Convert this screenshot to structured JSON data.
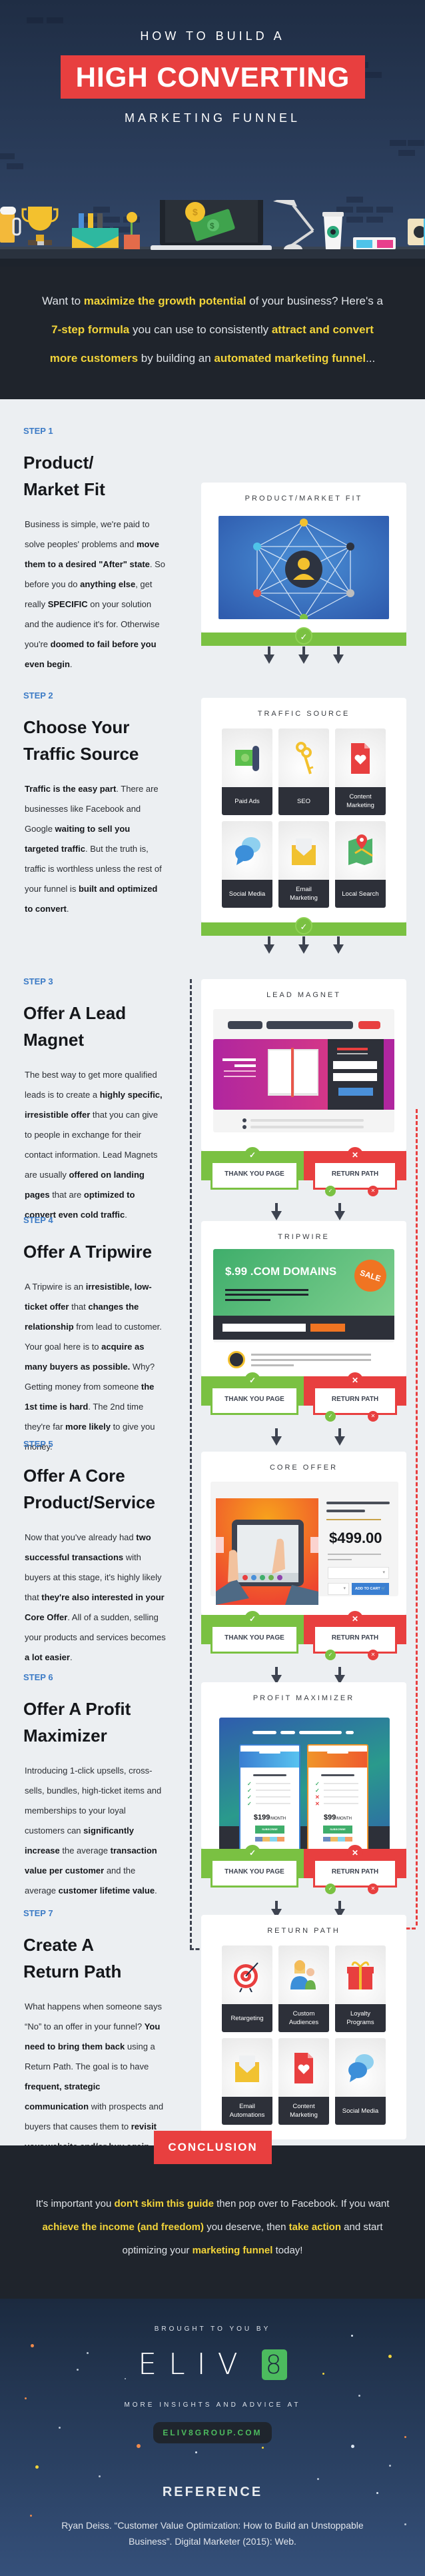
{
  "hero": {
    "pre_title": "HOW TO BUILD A",
    "badge": "HIGH CONVERTING",
    "post_title": "MARKETING FUNNEL"
  },
  "intro": {
    "parts": [
      {
        "t": "Want to ",
        "hl": false
      },
      {
        "t": "maximize the growth potential",
        "hl": true
      },
      {
        "t": " of your business? Here's a ",
        "hl": false
      },
      {
        "t": "7-step formula",
        "hl": true
      },
      {
        "t": " you can use to consistently ",
        "hl": false
      },
      {
        "t": "attract and convert more customers",
        "hl": true
      },
      {
        "t": " by building an ",
        "hl": false
      },
      {
        "t": "automated marketing funnel",
        "hl": true
      },
      {
        "t": "...",
        "hl": false
      }
    ]
  },
  "steps": [
    {
      "label": "STEP 1",
      "title": "Product/ Market Fit",
      "body": [
        {
          "t": "Business is simple, we're paid to solve peoples' problems and ",
          "b": false
        },
        {
          "t": "move them to a desired \"After\" state",
          "b": true
        },
        {
          "t": ". So before you do ",
          "b": false
        },
        {
          "t": "anything else",
          "b": true
        },
        {
          "t": ", get really ",
          "b": false
        },
        {
          "t": "SPECIFIC",
          "b": true
        },
        {
          "t": " on your solution and the audience it's for. Otherwise you're ",
          "b": false
        },
        {
          "t": "doomed to fail before you even begin",
          "b": true
        },
        {
          "t": ".",
          "b": false
        }
      ],
      "card_title": "PRODUCT/MARKET FIT"
    },
    {
      "label": "STEP 2",
      "title": "Choose Your Traffic Source",
      "body": [
        {
          "t": "Traffic is the easy part",
          "b": true
        },
        {
          "t": ". There are businesses like Facebook and Google ",
          "b": false
        },
        {
          "t": "waiting to sell you targeted traffic",
          "b": true
        },
        {
          "t": ". But the truth is, traffic is worthless unless the rest of your funnel is ",
          "b": false
        },
        {
          "t": "built and optimized to convert",
          "b": true
        },
        {
          "t": ".",
          "b": false
        }
      ],
      "card_title": "TRAFFIC SOURCE",
      "tiles": [
        {
          "label": "Paid Ads",
          "icon": "cash-icon"
        },
        {
          "label": "SEO",
          "icon": "key-icon"
        },
        {
          "label": "Content Marketing",
          "icon": "document-heart-icon"
        },
        {
          "label": "Social Media",
          "icon": "chat-bubbles-icon"
        },
        {
          "label": "Email Marketing",
          "icon": "envelope-icon"
        },
        {
          "label": "Local Search",
          "icon": "map-pin-icon"
        }
      ]
    },
    {
      "label": "STEP 3",
      "title": "Offer A Lead Magnet",
      "body": [
        {
          "t": "The best way to get more qualified leads is to create a ",
          "b": false
        },
        {
          "t": "highly specific, irresistible offer",
          "b": true
        },
        {
          "t": " that you can give to people in exchange for their contact information. Lead Magnets are usually ",
          "b": false
        },
        {
          "t": "offered on landing pages",
          "b": true
        },
        {
          "t": " that are ",
          "b": false
        },
        {
          "t": "optimized to convert even cold traffic",
          "b": true
        },
        {
          "t": ".",
          "b": false
        }
      ],
      "card_title": "LEAD MAGNET"
    },
    {
      "label": "STEP 4",
      "title": "Offer A Tripwire",
      "body": [
        {
          "t": "A Tripwire is an ",
          "b": false
        },
        {
          "t": "irresistible, low-ticket offer",
          "b": true
        },
        {
          "t": " that ",
          "b": false
        },
        {
          "t": "changes the relationship",
          "b": true
        },
        {
          "t": " from lead to customer. Your goal here is to ",
          "b": false
        },
        {
          "t": "acquire as many buyers as possible.",
          "b": true
        },
        {
          "t": " Why? Getting money from someone ",
          "b": false
        },
        {
          "t": "the 1st time is hard",
          "b": true
        },
        {
          "t": ". The 2nd time they're far ",
          "b": false
        },
        {
          "t": "more likely",
          "b": true
        },
        {
          "t": " to give you money.",
          "b": false
        }
      ],
      "card_title": "TRIPWIRE",
      "promo": "$.99 .COM DOMAINS",
      "sale": "SALE"
    },
    {
      "label": "STEP 5",
      "title": "Offer A Core Product/Service",
      "body": [
        {
          "t": "Now that you've already had ",
          "b": false
        },
        {
          "t": "two successful transactions",
          "b": true
        },
        {
          "t": " with buyers at this stage, it's highly likely that ",
          "b": false
        },
        {
          "t": "they're also interested in your Core Offer",
          "b": true
        },
        {
          "t": ". All of a sudden, selling your products and services becomes ",
          "b": false
        },
        {
          "t": "a lot easier",
          "b": true
        },
        {
          "t": ".",
          "b": false
        }
      ],
      "card_title": "CORE OFFER",
      "price": "$499.00",
      "cart_button": "ADD TO CART"
    },
    {
      "label": "STEP 6",
      "title": "Offer A Profit Maximizer",
      "body": [
        {
          "t": "Introducing 1-click upsells, cross-sells, bundles, high-ticket items and memberships to your loyal customers can ",
          "b": false
        },
        {
          "t": "significantly increase",
          "b": true
        },
        {
          "t": " the average ",
          "b": false
        },
        {
          "t": "transaction value per customer",
          "b": true
        },
        {
          "t": " and the average ",
          "b": false
        },
        {
          "t": "customer lifetime value",
          "b": true
        },
        {
          "t": ".",
          "b": false
        }
      ],
      "card_title": "PROFIT MAXIMIZER",
      "plans": [
        {
          "price": "$199",
          "period": "/MONTH",
          "button": "SUBSCRIBE",
          "features": [
            true,
            true,
            true,
            true
          ]
        },
        {
          "price": "$99",
          "period": "/MONTH",
          "button": "SUBSCRIBE",
          "features": [
            true,
            true,
            false,
            false
          ]
        }
      ]
    },
    {
      "label": "STEP 7",
      "title": "Create A Return Path",
      "body": [
        {
          "t": "What happens when someone says “No” to an offer in your funnel? ",
          "b": false
        },
        {
          "t": "You need to bring them back",
          "b": true
        },
        {
          "t": " using a Return Path. The goal is to have ",
          "b": false
        },
        {
          "t": "frequent, strategic communication",
          "b": true
        },
        {
          "t": " with prospects and buyers that causes them to ",
          "b": false
        },
        {
          "t": "revisit your website and/or buy again.",
          "b": true
        }
      ],
      "card_title": "RETURN PATH",
      "tiles": [
        {
          "label": "Retargeting",
          "icon": "target-icon"
        },
        {
          "label": "Custom Audiences",
          "icon": "people-icon"
        },
        {
          "label": "Loyalty Programs",
          "icon": "gift-icon"
        },
        {
          "label": "Email Automations",
          "icon": "envelope-icon"
        },
        {
          "label": "Content Marketing",
          "icon": "document-heart-icon"
        },
        {
          "label": "Social Media",
          "icon": "chat-bubbles-icon"
        }
      ]
    }
  ],
  "decision": {
    "yes": "THANK YOU PAGE",
    "no": "RETURN PATH"
  },
  "conclusion": {
    "badge": "CONCLUSION",
    "parts": [
      {
        "t": "It's important you ",
        "hl": false
      },
      {
        "t": "don't skim this guide",
        "hl": true
      },
      {
        "t": " then pop over to Facebook. If you want ",
        "hl": false
      },
      {
        "t": "achieve the income (and freedom)",
        "hl": true
      },
      {
        "t": " you deserve, then ",
        "hl": false
      },
      {
        "t": "take action",
        "hl": true
      },
      {
        "t": " and start optimizing your ",
        "hl": false
      },
      {
        "t": "marketing funnel",
        "hl": true
      },
      {
        "t": " today!",
        "hl": false
      }
    ]
  },
  "footer": {
    "brought_by": "BROUGHT TO YOU BY",
    "logo_text": "ELIV",
    "logo_badge": "8",
    "more": "MORE INSIGHTS AND ADVICE AT",
    "site": "ELIV8GROUP.COM",
    "ref_title": "REFERENCE",
    "ref_body": "Ryan Deiss. “Customer Value Optimization: How to Build an Unstoppable Business”. Digital Marketer (2015): Web."
  },
  "colors": {
    "accent_red": "#e83f3f",
    "accent_green": "#7ac142",
    "highlight_yellow": "#f2d43a",
    "step_blue": "#3c7bc6",
    "dark": "#1f242c"
  }
}
